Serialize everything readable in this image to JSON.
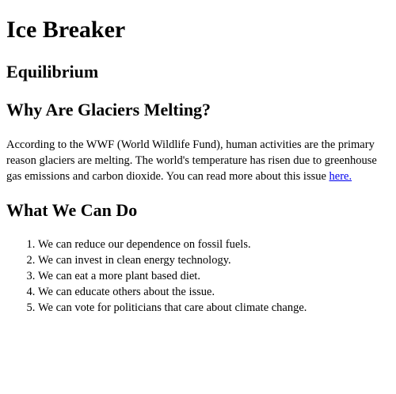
{
  "header": {
    "title": "Ice Breaker",
    "subtitle": "Equilibrium"
  },
  "section_why": {
    "heading": "Why Are Glaciers Melting?",
    "paragraph_text": "According to the WWF (World Wildlife Fund), human activities are the primary reason glaciers are melting. The world's temperature has risen due to greenhouse gas emissions and carbon dioxide. You can read more about this issue ",
    "link_text": "here."
  },
  "section_what": {
    "heading": "What We Can Do",
    "items": [
      "We can reduce our dependence on fossil fuels.",
      "We can invest in clean energy technology.",
      "We can eat a more plant based diet.",
      "We can educate others about the issue.",
      "We can vote for politicians that care about climate change."
    ]
  },
  "colors": {
    "text": "#000000",
    "link": "#0000ee",
    "background": "#ffffff"
  }
}
